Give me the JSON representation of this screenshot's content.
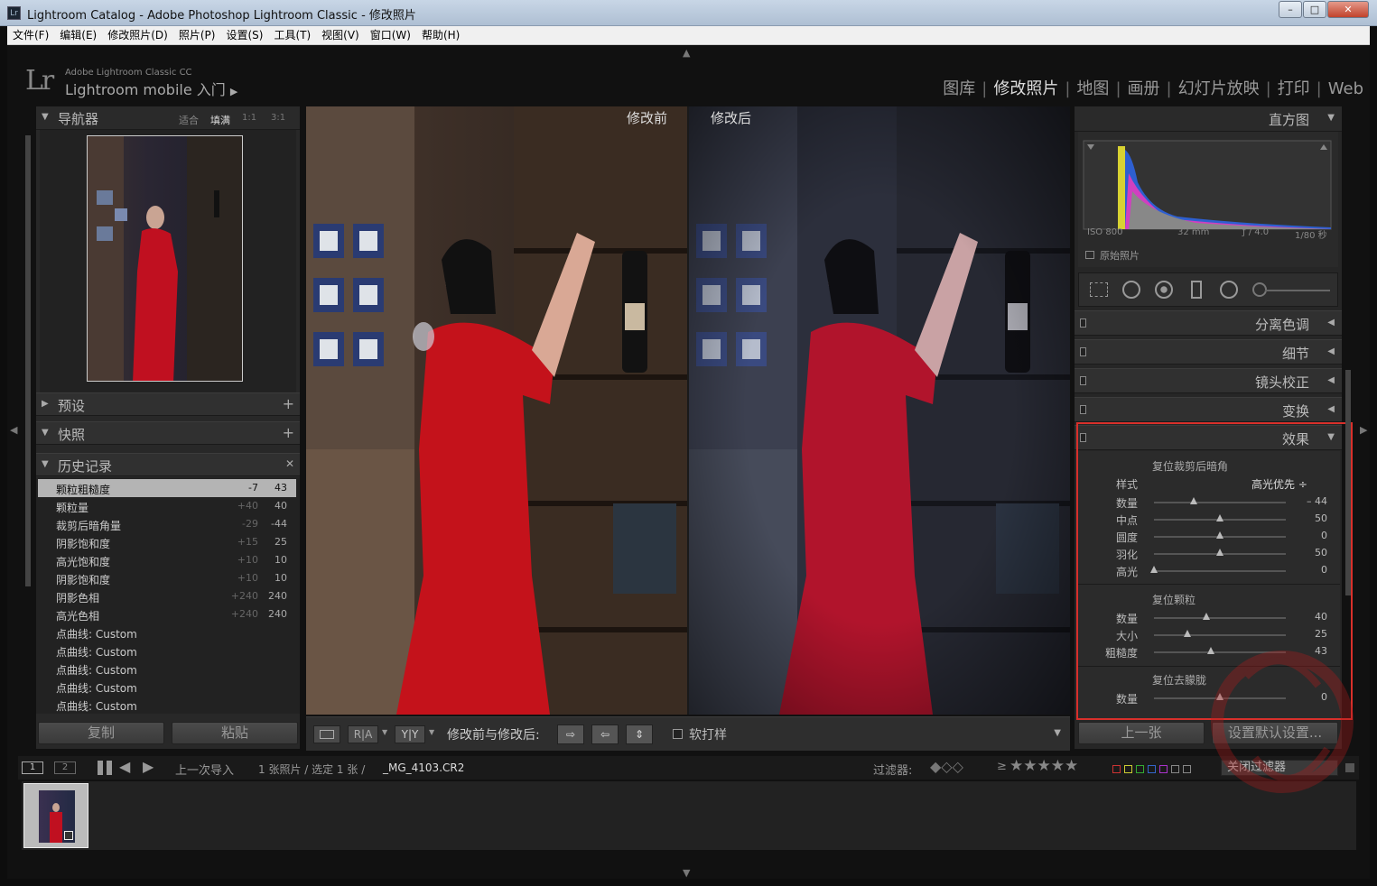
{
  "window": {
    "title": "Lightroom Catalog - Adobe Photoshop Lightroom Classic - 修改照片",
    "icon": "Lr",
    "controls": [
      "–",
      "□",
      "✕"
    ]
  },
  "menu": [
    "文件(F)",
    "编辑(E)",
    "修改照片(D)",
    "照片(P)",
    "设置(S)",
    "工具(T)",
    "视图(V)",
    "窗口(W)",
    "帮助(H)"
  ],
  "identity": {
    "logo": "Lr",
    "line1": "Adobe Lightroom Classic CC",
    "line2": "Lightroom mobile 入门",
    "arrow": "▶"
  },
  "modules": [
    "图库",
    "修改照片",
    "地图",
    "画册",
    "幻灯片放映",
    "打印",
    "Web"
  ],
  "active_module": "修改照片",
  "navigator": {
    "title": "导航器",
    "zoom": [
      "适合",
      "填满",
      "1:1",
      "3:1"
    ],
    "active_zoom": "填满"
  },
  "presets": {
    "title": "预设",
    "plus": "+"
  },
  "snapshots": {
    "title": "快照",
    "plus": "+"
  },
  "history": {
    "title": "历史记录",
    "close": "✕",
    "items": [
      {
        "name": "颗粒粗糙度",
        "a": "-7",
        "b": "43",
        "selected": true
      },
      {
        "name": "颗粒量",
        "a": "+40",
        "b": "40"
      },
      {
        "name": "裁剪后暗角量",
        "a": "-29",
        "b": "-44"
      },
      {
        "name": "阴影饱和度",
        "a": "+15",
        "b": "25"
      },
      {
        "name": "高光饱和度",
        "a": "+10",
        "b": "10"
      },
      {
        "name": "阴影饱和度",
        "a": "+10",
        "b": "10"
      },
      {
        "name": "阴影色相",
        "a": "+240",
        "b": "240"
      },
      {
        "name": "高光色相",
        "a": "+240",
        "b": "240"
      },
      {
        "name": "点曲线: Custom",
        "a": "",
        "b": ""
      },
      {
        "name": "点曲线: Custom",
        "a": "",
        "b": ""
      },
      {
        "name": "点曲线: Custom",
        "a": "",
        "b": ""
      },
      {
        "name": "点曲线: Custom",
        "a": "",
        "b": ""
      },
      {
        "name": "点曲线: Custom",
        "a": "",
        "b": ""
      }
    ]
  },
  "left_buttons": {
    "copy": "复制",
    "paste": "粘贴"
  },
  "compare": {
    "before": "修改前",
    "after": "修改后"
  },
  "toolbar": {
    "label": "修改前与修改后:",
    "soft_proof": "软打样",
    "ra": "R|A",
    "yy": "Y|Y"
  },
  "histogram": {
    "title": "直方图",
    "iso": "ISO 800",
    "focal": "32 mm",
    "aperture": "ƒ / 4.0",
    "shutter": "1/80 秒",
    "original": "原始照片"
  },
  "right_panels": [
    "分离色调",
    "细节",
    "镜头校正",
    "变换"
  ],
  "effects": {
    "title": "效果",
    "vignette": {
      "title": "复位裁剪后暗角",
      "style_label": "样式",
      "style_value": "高光优先 ÷",
      "sliders": [
        {
          "label": "数量",
          "value": "– 44",
          "pos": 0.3
        },
        {
          "label": "中点",
          "value": "50",
          "pos": 0.5
        },
        {
          "label": "圆度",
          "value": "0",
          "pos": 0.5
        },
        {
          "label": "羽化",
          "value": "50",
          "pos": 0.5
        },
        {
          "label": "高光",
          "value": "0",
          "pos": 0.0
        }
      ]
    },
    "grain": {
      "title": "复位颗粒",
      "sliders": [
        {
          "label": "数量",
          "value": "40",
          "pos": 0.4
        },
        {
          "label": "大小",
          "value": "25",
          "pos": 0.25
        },
        {
          "label": "粗糙度",
          "value": "43",
          "pos": 0.43
        }
      ]
    },
    "dehaze": {
      "title": "复位去朦胧",
      "sliders": [
        {
          "label": "数量",
          "value": "0",
          "pos": 0.5
        }
      ]
    }
  },
  "right_buttons": {
    "prev": "上一张",
    "reset": "设置默认设置..."
  },
  "filmstrip": {
    "page1": "1",
    "page2": "2",
    "source": "上一次导入",
    "count": "1 张照片 / 选定 1 张 /",
    "file": "_MG_4103.CR2",
    "filter": "过滤器:",
    "ge": "≥",
    "filter_off": "关闭过滤器"
  },
  "colors": {
    "accent_red": "#d9302b",
    "highlight": "#b4b4b4"
  }
}
